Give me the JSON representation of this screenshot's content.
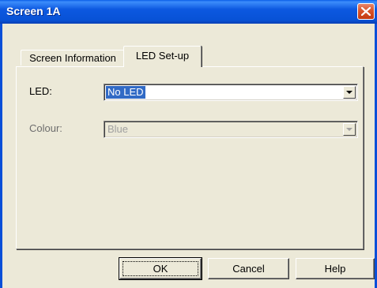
{
  "window": {
    "title": "Screen 1A"
  },
  "tabs": [
    {
      "label": "Screen Information",
      "active": false
    },
    {
      "label": "LED Set-up",
      "active": true
    }
  ],
  "form": {
    "led": {
      "label": "LED:",
      "value": "No LED",
      "selected": true,
      "enabled": true
    },
    "colour": {
      "label": "Colour:",
      "value": "Blue",
      "enabled": false
    }
  },
  "buttons": {
    "ok": "OK",
    "cancel": "Cancel",
    "help": "Help"
  },
  "icons": {
    "close": "close-icon",
    "dropdown": "chevron-down-icon"
  },
  "colors": {
    "titlebar": "#0a5ee8",
    "selection": "#316ac5",
    "close_button": "#d8542a"
  }
}
